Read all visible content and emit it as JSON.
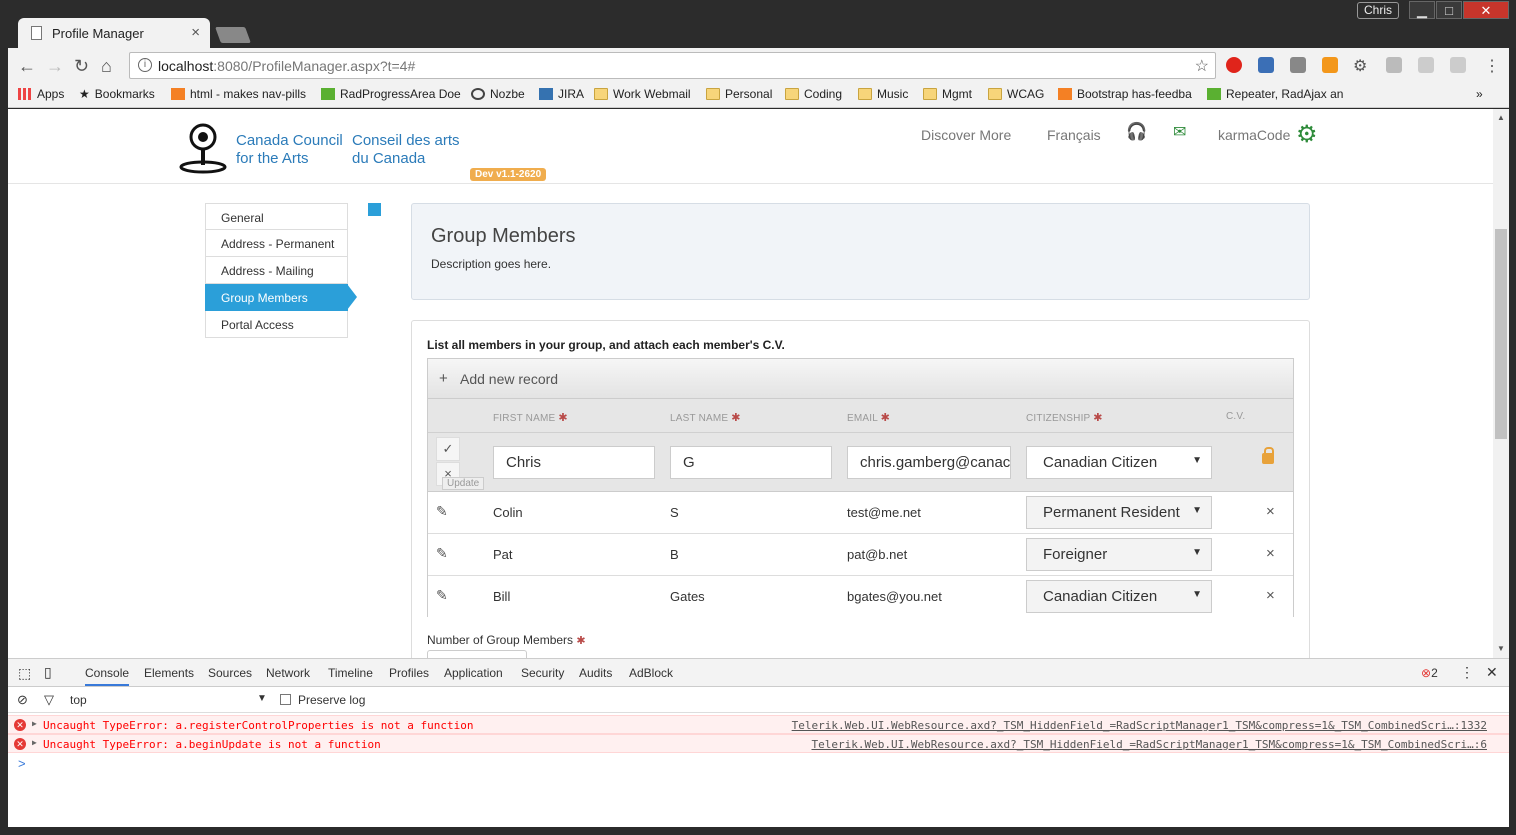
{
  "window": {
    "tab_title": "Profile Manager",
    "user_badge": "Chris",
    "minimize": "▁",
    "maximize": "□",
    "close": "✕"
  },
  "toolbar": {
    "url_host": "localhost",
    "url_rest": ":8080/ProfileManager.aspx?t=4#"
  },
  "bookmarks": [
    {
      "label": "Apps",
      "icon": "apps-grid-icon"
    },
    {
      "label": "Bookmarks",
      "icon": "star-icon"
    },
    {
      "label": "html - makes nav-pills",
      "icon": "stackoverflow-icon"
    },
    {
      "label": "RadProgressArea Doe",
      "icon": "telerik-icon"
    },
    {
      "label": "Nozbe",
      "icon": "check-circle-icon"
    },
    {
      "label": "JIRA",
      "icon": "jira-icon"
    },
    {
      "label": "Work Webmail",
      "icon": "folder-icon"
    },
    {
      "label": "Personal",
      "icon": "folder-icon"
    },
    {
      "label": "Coding",
      "icon": "folder-icon"
    },
    {
      "label": "Music",
      "icon": "folder-icon"
    },
    {
      "label": "Mgmt",
      "icon": "folder-icon"
    },
    {
      "label": "WCAG",
      "icon": "folder-icon"
    },
    {
      "label": "Bootstrap has-feedba",
      "icon": "stackoverflow-icon"
    },
    {
      "label": "Repeater, RadAjax an",
      "icon": "telerik-icon"
    }
  ],
  "site": {
    "logo_en": "Canada Council for the Arts",
    "logo_fr": "Conseil des arts du Canada",
    "dev_badge": "Dev v1.1-2620",
    "nav_discover": "Discover More",
    "nav_lang": "Français",
    "user": "karmaCode"
  },
  "sidenav": [
    "General",
    "Address - Permanent",
    "Address - Mailing",
    "Group Members",
    "Portal Access"
  ],
  "panel": {
    "title": "Group Members",
    "description": "Description goes here."
  },
  "grid": {
    "instructions": "List all members in your group, and attach each member's C.V.",
    "add_record": "Add new record",
    "columns": {
      "first": "FIRST NAME",
      "last": "LAST NAME",
      "email": "EMAIL",
      "citizenship": "CITIZENSHIP",
      "cv": "C.V."
    },
    "edit_row": {
      "first": "Chris",
      "last": "G",
      "email": "chris.gamberg@canac",
      "citizenship": "Canadian Citizen",
      "update_tip": "Update"
    },
    "rows": [
      {
        "first": "Colin",
        "last": "S",
        "email": "test@me.net",
        "citizenship": "Permanent Resident"
      },
      {
        "first": "Pat",
        "last": "B",
        "email": "pat@b.net",
        "citizenship": "Foreigner"
      },
      {
        "first": "Bill",
        "last": "Gates",
        "email": "bgates@you.net",
        "citizenship": "Canadian Citizen"
      }
    ],
    "number_label": "Number of Group Members"
  },
  "devtools": {
    "tabs": [
      "Console",
      "Elements",
      "Sources",
      "Network",
      "Timeline",
      "Profiles",
      "Application",
      "Security",
      "Audits",
      "AdBlock"
    ],
    "error_count": "2",
    "context": "top",
    "preserve_log": "Preserve log",
    "errors": [
      {
        "message": "Uncaught TypeError: a.registerControlProperties is not a function",
        "source": "Telerik.Web.UI.WebResource.axd?_TSM_HiddenField_=RadScriptManager1_TSM&compress=1&_TSM_CombinedScri…:1332"
      },
      {
        "message": "Uncaught TypeError: a.beginUpdate is not a function",
        "source": "Telerik.Web.UI.WebResource.axd?_TSM_HiddenField_=RadScriptManager1_TSM&compress=1&_TSM_CombinedScri…:6"
      }
    ],
    "prompt": ">"
  },
  "colors": {
    "accent": "#2b9fd9",
    "brand": "#2b7bb9",
    "error": "#ff0000",
    "dev_badge": "#f0ad4e"
  }
}
